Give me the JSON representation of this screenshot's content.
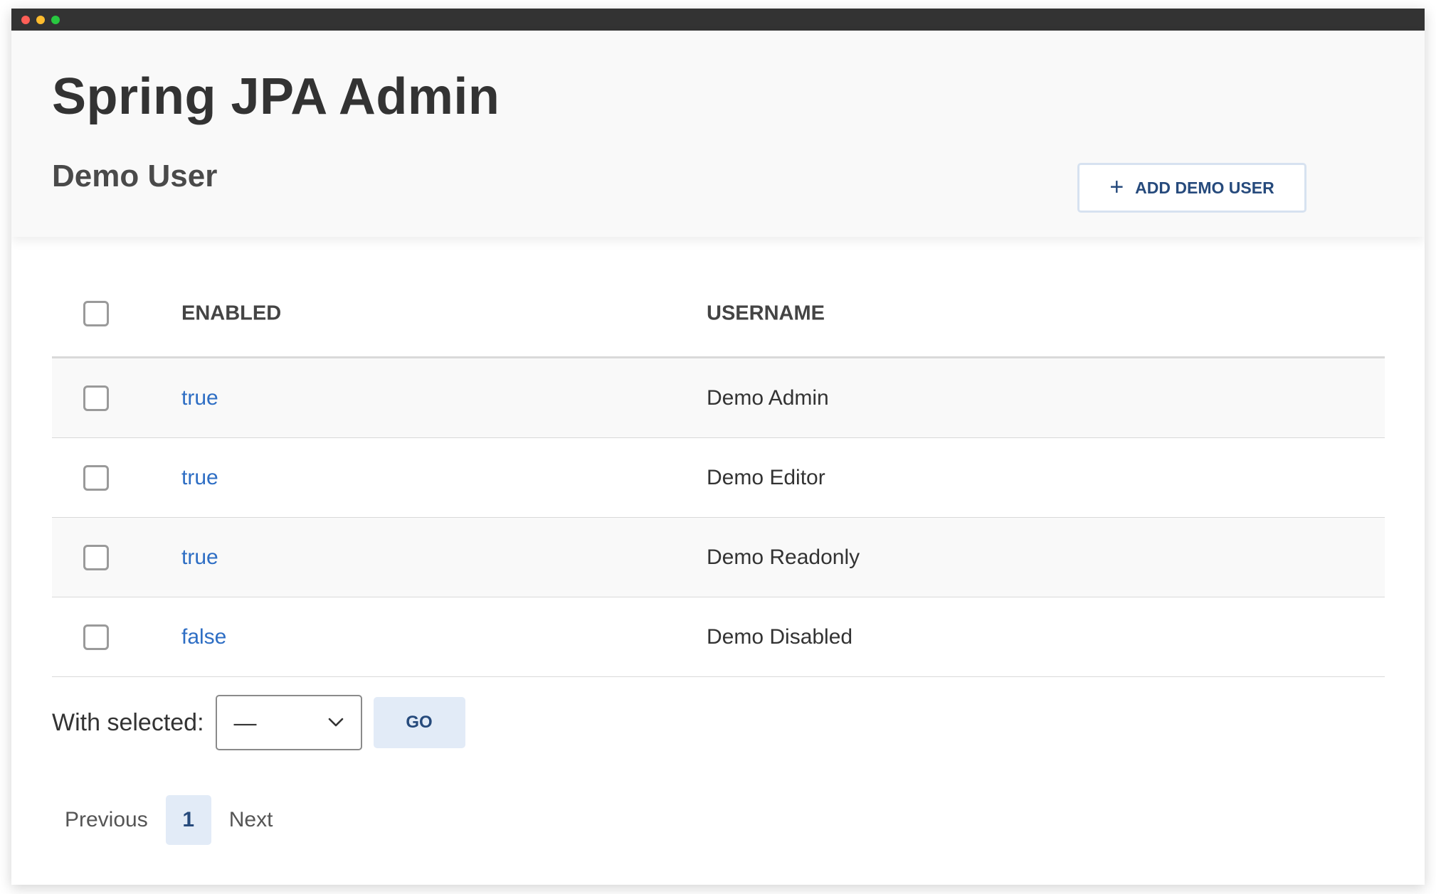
{
  "app": {
    "title": "Spring JPA Admin"
  },
  "page": {
    "subtitle": "Demo User",
    "add_button_label": "ADD DEMO USER"
  },
  "table": {
    "columns": [
      "ENABLED",
      "USERNAME"
    ],
    "rows": [
      {
        "enabled": "true",
        "username": "Demo Admin"
      },
      {
        "enabled": "true",
        "username": "Demo Editor"
      },
      {
        "enabled": "true",
        "username": "Demo Readonly"
      },
      {
        "enabled": "false",
        "username": "Demo Disabled"
      }
    ]
  },
  "bulk_action": {
    "label": "With selected:",
    "selected_value": "—",
    "go_label": "GO"
  },
  "pagination": {
    "previous_label": "Previous",
    "current_page": "1",
    "next_label": "Next"
  },
  "colors": {
    "accent": "#264a7c",
    "link": "#2e6ec4",
    "button_bg": "#e2ebf7",
    "titlebar": "#333333"
  },
  "icons": {
    "add": "plus-icon",
    "select": "chevron-down-icon"
  }
}
